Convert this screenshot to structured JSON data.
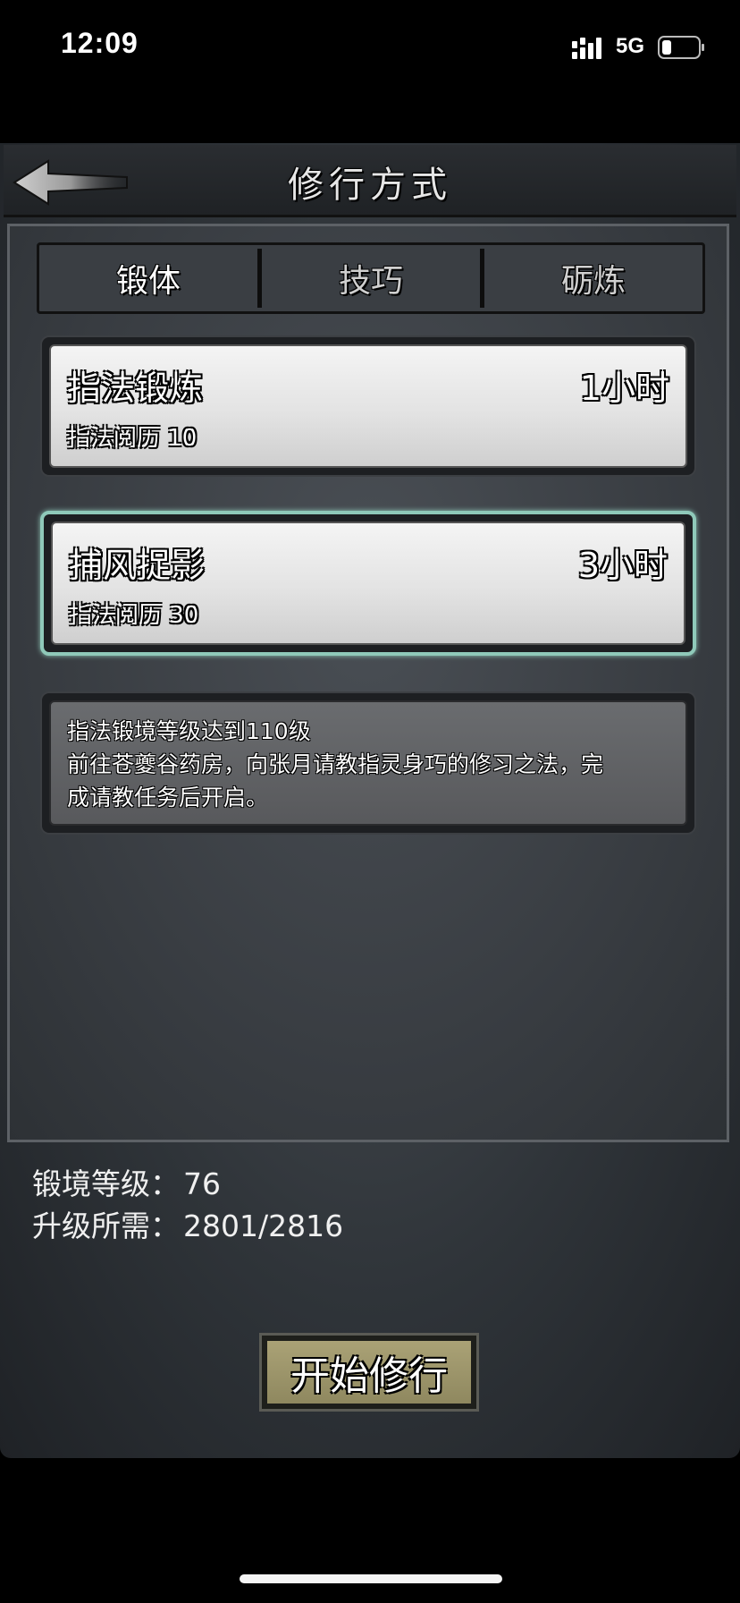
{
  "status_bar": {
    "time": "12:09",
    "network": "5G"
  },
  "header": {
    "title": "修行方式"
  },
  "tabs": [
    {
      "label": "锻体",
      "active": true
    },
    {
      "label": "技巧",
      "active": false
    },
    {
      "label": "砺炼",
      "active": false
    }
  ],
  "trainings": [
    {
      "name": "指法锻炼",
      "duration": "1小时",
      "reward": "指法阅历 10",
      "selected": false
    },
    {
      "name": "捕风捉影",
      "duration": "3小时",
      "reward": "指法阅历 30",
      "selected": true
    }
  ],
  "locked": {
    "line1": "指法锻境等级达到110级",
    "line2": "前往苍夔谷药房，向张月请教指灵身巧的修习之法，完",
    "line3": "成请教任务后开启。"
  },
  "stats": {
    "level_label": "锻境等级：",
    "level_value": "76",
    "upgrade_label": "升级所需：",
    "upgrade_value": "2801/2816"
  },
  "actions": {
    "start_label": "开始修行"
  },
  "colors": {
    "selected_border": "#8fc9b9",
    "start_button": "#a39b6e"
  }
}
